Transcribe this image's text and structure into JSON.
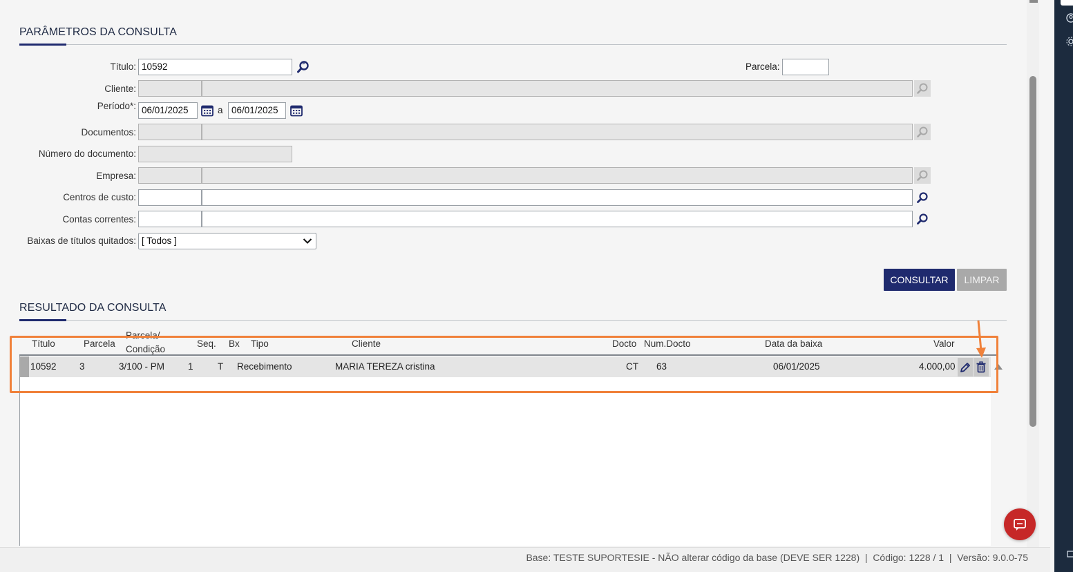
{
  "params": {
    "title": "PARÂMETROS DA CONSULTA",
    "titulo_label": "Título:",
    "titulo_value": "10592",
    "parcela_label": "Parcela:",
    "parcela_value": "",
    "cliente_label": "Cliente:",
    "periodo_label": "Período*:",
    "periodo_from": "06/01/2025",
    "periodo_sep": "a",
    "periodo_to": "06/01/2025",
    "documentos_label": "Documentos:",
    "numero_documento_label": "Número do documento:",
    "empresa_label": "Empresa:",
    "centros_label": "Centros de custo:",
    "contas_label": "Contas correntes:",
    "baixas_label": "Baixas de títulos quitados:",
    "baixas_value": "[ Todos ]",
    "consultar_label": "CONSULTAR",
    "limpar_label": "LIMPAR"
  },
  "results": {
    "title": "RESULTADO DA CONSULTA",
    "columns": {
      "titulo": "Título",
      "parcela": "Parcela",
      "parcela_condicao_1": "Parcela/",
      "parcela_condicao_2": "Condição",
      "seq": "Seq.",
      "bx": "Bx",
      "tipo": "Tipo",
      "cliente": "Cliente",
      "docto": "Docto",
      "num_docto": "Num.Docto",
      "data_baixa": "Data da baixa",
      "valor": "Valor"
    },
    "rows": [
      {
        "titulo": "10592",
        "parcela": "3",
        "parcela_condicao": "3/100 - PM",
        "seq": "1",
        "bx": "T",
        "tipo": "Recebimento",
        "cliente": "MARIA TEREZA cristina",
        "docto": "CT",
        "num_docto": "63",
        "data_baixa": "06/01/2025",
        "valor": "4.000,00"
      }
    ]
  },
  "footer": {
    "status": "Base: TESTE SUPORTESIE - NÃO alterar código da base (DEVE SER 1228)  |  Código: 1228 / 1  |  Versão: 9.0.0-75"
  },
  "colors": {
    "primary": "#1f2a6e",
    "highlight": "#f0813a",
    "chat": "#c62828",
    "sidebar": "#1c2b3e"
  },
  "icons": [
    "search-icon",
    "calendar-icon",
    "chevron-down-icon",
    "pencil-icon",
    "trash-icon",
    "chat-icon",
    "user-icon",
    "gear-icon"
  ]
}
